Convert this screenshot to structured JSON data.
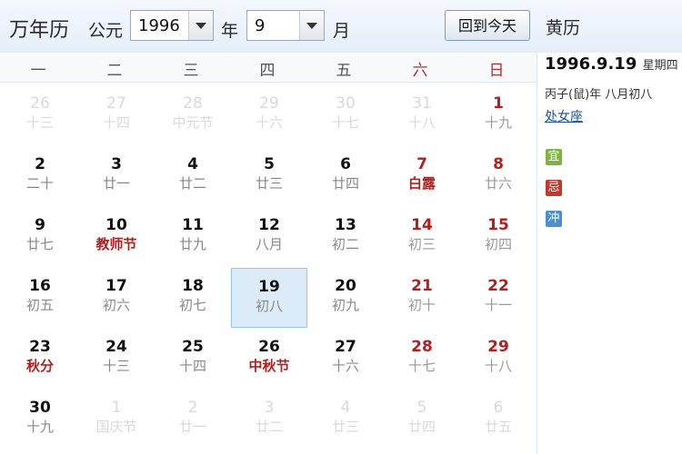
{
  "header": {
    "app_title": "万年历",
    "era_label": "公元",
    "year": "1996",
    "year_label": "年",
    "month": "9",
    "month_label": "月",
    "today_button": "回到今天",
    "panel_title": "黄历"
  },
  "weekdays": [
    "一",
    "二",
    "三",
    "四",
    "五",
    "六",
    "日"
  ],
  "weeks": [
    [
      {
        "day": "26",
        "lunar": "十三",
        "type": "other"
      },
      {
        "day": "27",
        "lunar": "十四",
        "type": "other"
      },
      {
        "day": "28",
        "lunar": "中元节",
        "type": "other"
      },
      {
        "day": "29",
        "lunar": "十六",
        "type": "other"
      },
      {
        "day": "30",
        "lunar": "十七",
        "type": "other"
      },
      {
        "day": "31",
        "lunar": "十八",
        "type": "other"
      },
      {
        "day": "1",
        "lunar": "十九",
        "type": "weekend"
      }
    ],
    [
      {
        "day": "2",
        "lunar": "二十",
        "type": "normal"
      },
      {
        "day": "3",
        "lunar": "廿一",
        "type": "normal"
      },
      {
        "day": "4",
        "lunar": "廿二",
        "type": "normal"
      },
      {
        "day": "5",
        "lunar": "廿三",
        "type": "normal"
      },
      {
        "day": "6",
        "lunar": "廿四",
        "type": "normal"
      },
      {
        "day": "7",
        "lunar": "白露",
        "type": "weekend-fest"
      },
      {
        "day": "8",
        "lunar": "廿六",
        "type": "weekend"
      }
    ],
    [
      {
        "day": "9",
        "lunar": "廿七",
        "type": "normal"
      },
      {
        "day": "10",
        "lunar": "教师节",
        "type": "fest"
      },
      {
        "day": "11",
        "lunar": "廿九",
        "type": "normal"
      },
      {
        "day": "12",
        "lunar": "八月",
        "type": "normal"
      },
      {
        "day": "13",
        "lunar": "初二",
        "type": "normal"
      },
      {
        "day": "14",
        "lunar": "初三",
        "type": "weekend"
      },
      {
        "day": "15",
        "lunar": "初四",
        "type": "weekend"
      }
    ],
    [
      {
        "day": "16",
        "lunar": "初五",
        "type": "normal"
      },
      {
        "day": "17",
        "lunar": "初六",
        "type": "normal"
      },
      {
        "day": "18",
        "lunar": "初七",
        "type": "normal"
      },
      {
        "day": "19",
        "lunar": "初八",
        "type": "today"
      },
      {
        "day": "20",
        "lunar": "初九",
        "type": "normal"
      },
      {
        "day": "21",
        "lunar": "初十",
        "type": "weekend"
      },
      {
        "day": "22",
        "lunar": "十一",
        "type": "weekend"
      }
    ],
    [
      {
        "day": "23",
        "lunar": "秋分",
        "type": "fest"
      },
      {
        "day": "24",
        "lunar": "十三",
        "type": "normal"
      },
      {
        "day": "25",
        "lunar": "十四",
        "type": "normal"
      },
      {
        "day": "26",
        "lunar": "中秋节",
        "type": "fest"
      },
      {
        "day": "27",
        "lunar": "十六",
        "type": "normal"
      },
      {
        "day": "28",
        "lunar": "十七",
        "type": "weekend"
      },
      {
        "day": "29",
        "lunar": "十八",
        "type": "weekend"
      }
    ],
    [
      {
        "day": "30",
        "lunar": "十九",
        "type": "normal"
      },
      {
        "day": "1",
        "lunar": "国庆节",
        "type": "other"
      },
      {
        "day": "2",
        "lunar": "廿一",
        "type": "other"
      },
      {
        "day": "3",
        "lunar": "廿二",
        "type": "other"
      },
      {
        "day": "4",
        "lunar": "廿三",
        "type": "other"
      },
      {
        "day": "5",
        "lunar": "廿四",
        "type": "other"
      },
      {
        "day": "6",
        "lunar": "廿五",
        "type": "other"
      }
    ]
  ],
  "side": {
    "date": "1996.9.19",
    "weekday": "星期四",
    "lunar": "丙子(鼠)年 八月初八",
    "zodiac": "处女座",
    "badges": [
      {
        "text": "宜",
        "color": "#7cb342"
      },
      {
        "text": "忌",
        "color": "#c0392b"
      },
      {
        "text": "冲",
        "color": "#4a8fd0"
      }
    ]
  },
  "colors": {
    "accent": "#dcebf8",
    "weekend": "#b02020",
    "festival": "#b02020"
  }
}
